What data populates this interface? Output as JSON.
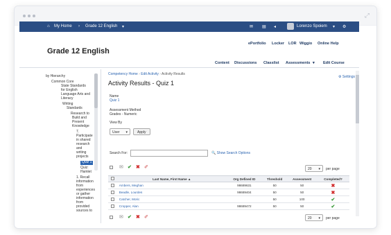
{
  "nav": {
    "home": "My Home",
    "course": "Grade 12 English",
    "user": "Lorenzo Spoiem"
  },
  "header": {
    "course_title": "Grade 12 English",
    "top_links": [
      "ePortfolio",
      "Locker",
      "LOR",
      "Wiggio",
      "Online Help"
    ],
    "nav_links": [
      "Content",
      "Discussions",
      "Classlist",
      "Assessments",
      "Edit Course"
    ]
  },
  "tree": {
    "nodes": [
      "by Hierarchy",
      "Common Core",
      "State Standards",
      "for English",
      "Language Arts and",
      "Literacy",
      "Writing",
      "Standards",
      "Research to",
      "Build and",
      "Present",
      "Knowledge",
      "7.",
      "Participate",
      "in shared",
      "research",
      "and",
      "writing",
      "projects",
      "Quiz 1",
      "Quiz:",
      "Hamlet",
      "1. Recall",
      "information",
      "from",
      "experiences",
      "or gather",
      "information",
      "from",
      "provided",
      "sources to"
    ],
    "selected": "Quiz 1"
  },
  "main": {
    "breadcrumb": [
      "Competency Home",
      "Edit Activity",
      "Activity Results"
    ],
    "title": "Activity Results - Quiz 1",
    "settings": "Settings",
    "name_label": "Name",
    "name_value": "Quiz 1",
    "method_label": "Assessment Method",
    "method_value": "Grades - Numeric",
    "view_by_label": "View By",
    "view_by_value": "User",
    "apply_label": "Apply",
    "search_label": "Search For:",
    "search_placeholder": "",
    "show_search_options": "Show Search Options",
    "per_page_value": "20",
    "per_page_label": "per page"
  },
  "table": {
    "headers": [
      "Last Name, First Name",
      "Org Defined ID",
      "Threshold",
      "Assessment",
      "Completed?"
    ],
    "rows": [
      {
        "name": "Ambers, Meghan",
        "org_id": "98689631",
        "threshold": "50",
        "assessment": "50",
        "completed": false
      },
      {
        "name": "Beadle, Lourdes",
        "org_id": "98689404",
        "threshold": "50",
        "assessment": "50",
        "completed": false
      },
      {
        "name": "Catcher, Moric",
        "org_id": "",
        "threshold": "50",
        "assessment": "100",
        "completed": true
      },
      {
        "name": "Cropper, Alan",
        "org_id": "98689472",
        "threshold": "50",
        "assessment": "50",
        "completed": true
      }
    ]
  },
  "colors": {
    "navbar": "#2b4e84",
    "link": "#2b64b0",
    "complete": "#3a9a3a",
    "incomplete": "#d12d2d"
  }
}
